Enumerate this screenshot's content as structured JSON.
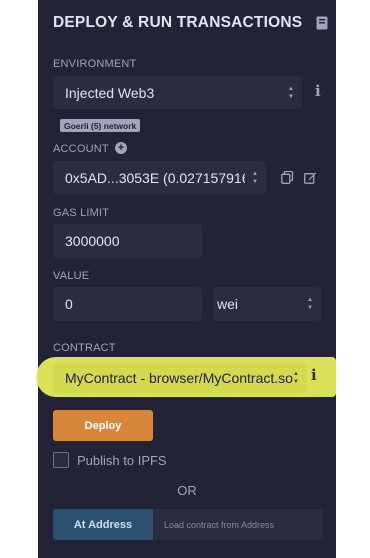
{
  "panel": {
    "title": "DEPLOY & RUN TRANSACTIONS",
    "title_icon": "book-icon"
  },
  "environment": {
    "label": "ENVIRONMENT",
    "value": "Injected Web3",
    "network_badge": "Goerli (5) network"
  },
  "account": {
    "label": "ACCOUNT",
    "value": "0x5AD...3053E (0.0271579162...",
    "add_icon": "plus-circle-icon",
    "copy_icon": "copy-icon",
    "edit_icon": "edit-icon"
  },
  "gas_limit": {
    "label": "GAS LIMIT",
    "value": "3000000"
  },
  "value": {
    "label": "VALUE",
    "amount": "0",
    "unit": "wei"
  },
  "contract": {
    "label": "CONTRACT",
    "value": "MyContract - browser/MyContract.sol"
  },
  "actions": {
    "deploy_label": "Deploy",
    "publish_label": "Publish to IPFS",
    "or_label": "OR",
    "at_address_label": "At Address",
    "address_placeholder": "Load contract from Address"
  },
  "colors": {
    "panel_bg": "#222336",
    "field_bg": "#2a2c3f",
    "deploy": "#d68739",
    "at_address": "#2c5072",
    "highlight": "#e4ec5c"
  }
}
